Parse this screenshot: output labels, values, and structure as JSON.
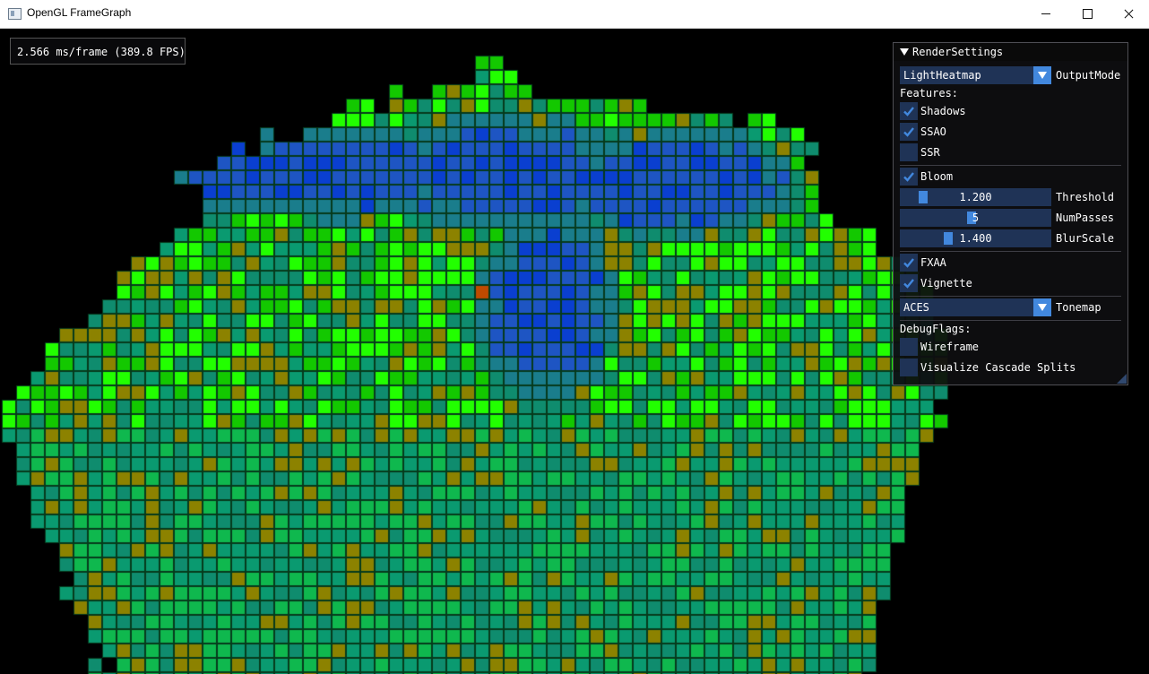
{
  "window": {
    "title": "OpenGL FrameGraph"
  },
  "stats": {
    "text": "2.566 ms/frame (389.8 FPS)"
  },
  "render_settings": {
    "title": "RenderSettings",
    "output_mode": {
      "value": "LightHeatmap",
      "label": "OutputMode"
    },
    "features_label": "Features:",
    "shadows": {
      "label": "Shadows",
      "checked": true
    },
    "ssao": {
      "label": "SSAO",
      "checked": true
    },
    "ssr": {
      "label": "SSR",
      "checked": false
    },
    "bloom": {
      "label": "Bloom",
      "checked": true,
      "threshold": {
        "value": "1.200",
        "label": "Threshold",
        "fraction": 0.12
      },
      "num_passes": {
        "value": "5",
        "label": "NumPasses",
        "fraction": 0.47
      },
      "blur_scale": {
        "value": "1.400",
        "label": "BlurScale",
        "fraction": 0.3
      }
    },
    "fxaa": {
      "label": "FXAA",
      "checked": true
    },
    "vignette": {
      "label": "Vignette",
      "checked": true
    },
    "tonemap": {
      "value": "ACES",
      "label": "Tonemap"
    },
    "debug_flags_label": "DebugFlags:",
    "wireframe": {
      "label": "Wireframe",
      "checked": false
    },
    "visualize_cascade_splits": {
      "label": "Visualize Cascade Splits",
      "checked": false
    }
  },
  "colors": {
    "accent": "#4288de",
    "frame_bg": "#1f3356",
    "heat_low": "#00b400",
    "heat_green": "#00ff00",
    "heat_teal": "#008c6e",
    "heat_blue": "#1e50be",
    "heat_olive": "#8c8c00",
    "heat_orange": "#b45000"
  }
}
